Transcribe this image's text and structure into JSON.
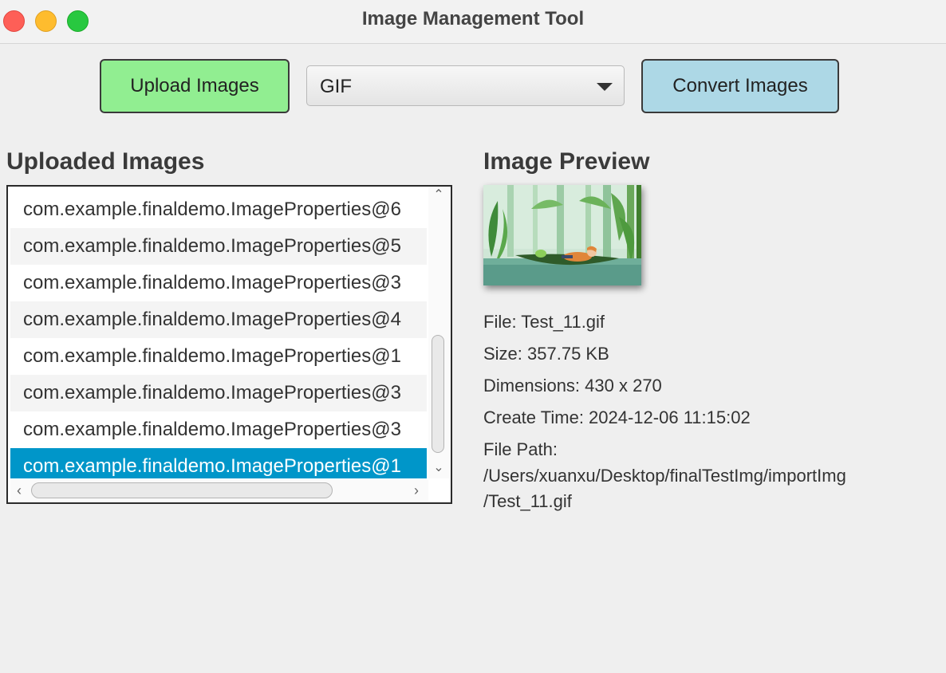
{
  "window": {
    "title": "Image Management Tool"
  },
  "toolbar": {
    "upload_label": "Upload Images",
    "format_selected": "GIF",
    "convert_label": "Convert Images"
  },
  "left_panel": {
    "title": "Uploaded Images",
    "items": [
      "com.example.finaldemo.ImageProperties@6",
      "com.example.finaldemo.ImageProperties@5",
      "com.example.finaldemo.ImageProperties@3",
      "com.example.finaldemo.ImageProperties@4",
      "com.example.finaldemo.ImageProperties@1",
      "com.example.finaldemo.ImageProperties@3",
      "com.example.finaldemo.ImageProperties@3",
      "com.example.finaldemo.ImageProperties@1"
    ],
    "selected_index": 7
  },
  "right_panel": {
    "title": "Image Preview",
    "file": "File: Test_11.gif",
    "size": "Size: 357.75 KB",
    "dimensions": "Dimensions: 430 x 270",
    "create_time": "Create Time: 2024-12-06 11:15:02",
    "path_label": "File Path:",
    "path_line1": "/Users/xuanxu/Desktop/finalTestImg/importImg",
    "path_line2": "/Test_11.gif"
  },
  "colors": {
    "upload_button": "#91ee91",
    "convert_button": "#add8e6",
    "selection": "#0096c9"
  }
}
